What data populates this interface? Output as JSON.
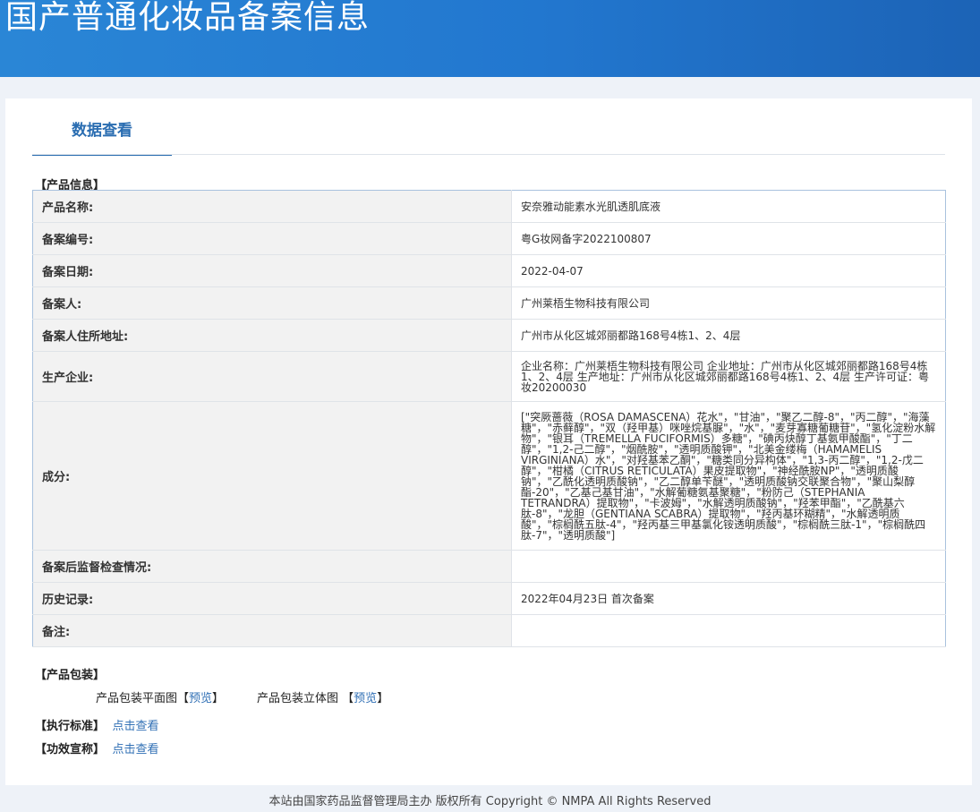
{
  "header": {
    "title": "国产普通化妆品备案信息"
  },
  "tab": {
    "label": "数据查看"
  },
  "sections": {
    "product_info": "【产品信息】",
    "packaging": "【产品包装】",
    "standard": "【执行标准】",
    "efficacy": "【功效宣称】"
  },
  "rows": [
    {
      "key": "产品名称:",
      "value": "安奈雅动能素水光肌透肌底液"
    },
    {
      "key": "备案编号:",
      "value": "粤G妆网备字2022100807"
    },
    {
      "key": "备案日期:",
      "value": "2022-04-07"
    },
    {
      "key": "备案人:",
      "value": "广州莱梧生物科技有限公司"
    },
    {
      "key": "备案人住所地址:",
      "value": "广州市从化区城郊丽都路168号4栋1、2、4层"
    },
    {
      "key": "生产企业:",
      "value": "企业名称：广州莱梧生物科技有限公司 企业地址：广州市从化区城郊丽都路168号4栋1、2、4层 生产地址：广州市从化区城郊丽都路168号4栋1、2、4层 生产许可证：粤妆20200030"
    },
    {
      "key": "成分:",
      "value": "[\"突厥蔷薇（ROSA DAMASCENA）花水\"，\"甘油\"，\"聚乙二醇-8\"，\"丙二醇\"，\"海藻糖\"，\"赤藓醇\"，\"双（羟甲基）咪唑烷基脲\"，\"水\"，\"麦芽寡糖葡糖苷\"，\"氢化淀粉水解物\"，\"银耳（TREMELLA FUCIFORMIS）多糖\"，\"碘丙炔醇丁基氨甲酸酯\"，\"丁二醇\"，\"1,2-己二醇\"，\"烟酰胺\"，\"透明质酸钾\"，\"北美金缕梅（HAMAMELIS VIRGINIANA）水\"，\"对羟基苯乙酮\"，\"糖类同分异构体\"，\"1,3-丙二醇\"，\"1,2-戊二醇\"，\"柑橘（CITRUS RETICULATA）果皮提取物\"，\"神经酰胺NP\"，\"透明质酸钠\"，\"乙酰化透明质酸钠\"，\"乙二醇单苄醚\"，\"透明质酸钠交联聚合物\"，\"聚山梨醇酯-20\"，\"乙基己基甘油\"，\"水解葡糖氨基聚糖\"，\"粉防己（STEPHANIA TETRANDRA）提取物\"，\"卡波姆\"，\"水解透明质酸钠\"，\"羟苯甲酯\"，\"乙酰基六肽-8\"，\"龙胆（GENTIANA SCABRA）提取物\"，\"羟丙基环糊精\"，\"水解透明质酸\"，\"棕榈酰五肽-4\"，\"羟丙基三甲基氯化铵透明质酸\"，\"棕榈酰三肽-1\"，\"棕榈酰四肽-7\"，\"透明质酸\"]"
    },
    {
      "key": "备案后监督检查情况:",
      "value": ""
    },
    {
      "key": "历史记录:",
      "value": "2022年04月23日 首次备案"
    },
    {
      "key": "备注:",
      "value": ""
    }
  ],
  "packaging": {
    "flat_label": "产品包装平面图",
    "flat_link": "预览",
    "solid_label": "产品包装立体图",
    "solid_link": "预览",
    "bracket_open": "【",
    "bracket_close": "】"
  },
  "links": {
    "standard": "点击查看",
    "efficacy": "点击查看"
  },
  "footer": {
    "text": "本站由国家药品监督管理局主办 版权所有 Copyright © NMPA All Rights Reserved"
  }
}
